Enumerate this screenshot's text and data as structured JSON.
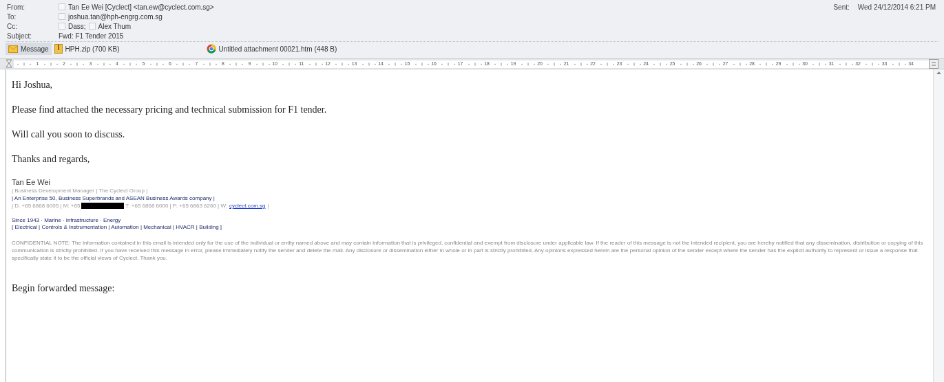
{
  "header": {
    "fields": [
      {
        "label": "From:",
        "recipients": [
          "Tan Ee Wei [Cyclect] <tan.ew@cyclect.com.sg>"
        ]
      },
      {
        "label": "To:",
        "recipients": [
          "joshua.tan@hph-engrg.com.sg"
        ]
      },
      {
        "label": "Cc:",
        "recipients": [
          "Dass;",
          "Alex Thum"
        ]
      },
      {
        "label": "Subject:",
        "value": "Fwd: F1 Tender 2015"
      }
    ],
    "sent": {
      "label": "Sent:",
      "value": "Wed 24/12/2014 6:21 PM"
    }
  },
  "attachments": [
    {
      "kind": "message",
      "label": "Message",
      "selected": true
    },
    {
      "kind": "zip",
      "label": "HPH.zip (700 KB)",
      "selected": false
    },
    {
      "kind": "htm",
      "label": "Untitled attachment 00021.htm (448 B)",
      "selected": false
    }
  ],
  "ruler": [
    "1",
    "2",
    "3",
    "4",
    "5",
    "6",
    "7",
    "8",
    "9",
    "10",
    "11",
    "12",
    "13",
    "14",
    "15",
    "16",
    "17",
    "18",
    "19",
    "20",
    "21",
    "22",
    "23",
    "24",
    "25",
    "26",
    "27",
    "28",
    "29",
    "30",
    "31",
    "32",
    "33",
    "34"
  ],
  "body": {
    "paragraphs": [
      "Hi Joshua,",
      "Please find attached the necessary pricing and technical submission for F1 tender.",
      "Will call you soon to discuss.",
      "Thanks and regards,"
    ],
    "signature": {
      "name": "Tan Ee Wei",
      "title": "| Business Development Manager | The Cyclect Group |",
      "tagline": "| An Enterprise 50, Business Superbrands and ASEAN Business Awards company |",
      "phone_before": "| D: +65 6868 6005 | M: +65",
      "phone_after": "T: +65 6868 6000 | F: +65 6863 6260 | W:",
      "link": "cyclect.com.sg",
      "phone_end": "|",
      "since": "Since 1943 · Marine · Infrastructure · Energy",
      "services": "[ Electrical | Controls & Instrumentation | Automation | Mechanical | HVACR | Building ]"
    },
    "disclaimer": "CONFIDENTIAL NOTE: The information contained in this email is intended only for the use of the individual or entity named above and may contain information that is privileged, confidential and exempt from disclosure under applicable law. If the reader of this message is not the intended recipient, you are hereby notified that any dissemination, distribution or copying of this communication is strictly prohibited. If you have received this message in error, please immediately notify the sender and delete the mail. Any disclosure or dissemination either in whole or in part is strictly prohibited. Any opinions expressed herein are the personal opinion of the sender except where the sender has the explicit authority to represent or issue a response that specifically state it to be the official views of Cyclect. Thank you.",
    "forwarded": "Begin forwarded message:"
  }
}
